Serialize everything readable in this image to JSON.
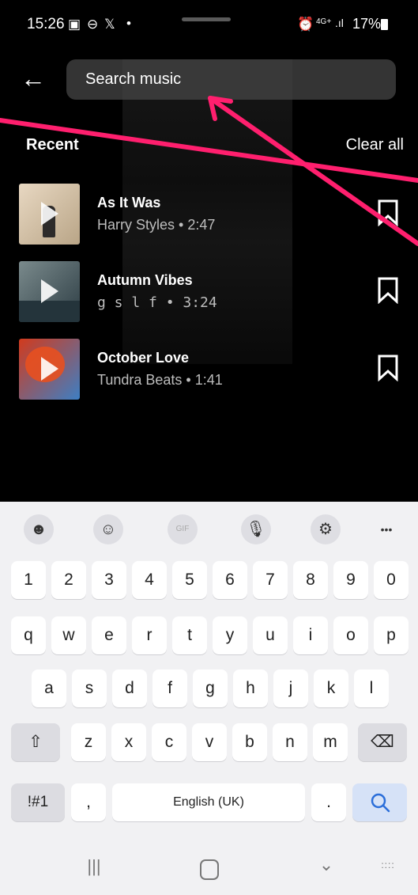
{
  "status_bar": {
    "time": "15:26",
    "left_icons": [
      "gallery-icon",
      "minus-circle-icon",
      "x-logo-icon",
      "dot-icon"
    ],
    "right_icons": [
      "alarm-icon",
      "4g-signal-icon"
    ],
    "network": "4G+",
    "battery": "17%"
  },
  "search": {
    "placeholder": "Search music"
  },
  "recent": {
    "title": "Recent",
    "clear_label": "Clear all"
  },
  "tracks": [
    {
      "title": "As It Was",
      "subtitle": "Harry Styles • 2:47",
      "thumb_colors": [
        "#e8d8c2",
        "#b9a587"
      ]
    },
    {
      "title": "Autumn Vibes",
      "subtitle": "g s l f • 3:24",
      "thumb_colors": [
        "#7a8a8c",
        "#2d3d44"
      ]
    },
    {
      "title": "October Love",
      "subtitle": "Tundra Beats • 1:41",
      "thumb_colors": [
        "#d23a1c",
        "#3d7fc4"
      ]
    }
  ],
  "annotation": {
    "arrow_color": "#ff1f6e"
  },
  "keyboard": {
    "toolbar": [
      "sticker-icon",
      "emoji-icon",
      "gif-icon",
      "microphone-icon",
      "settings-icon",
      "more-icon"
    ],
    "toolbar_gif": "GIF",
    "toolbar_more": "•••",
    "row_numbers": [
      "1",
      "2",
      "3",
      "4",
      "5",
      "6",
      "7",
      "8",
      "9",
      "0"
    ],
    "row_q": [
      "q",
      "w",
      "e",
      "r",
      "t",
      "y",
      "u",
      "i",
      "o",
      "p"
    ],
    "row_a": [
      "a",
      "s",
      "d",
      "f",
      "g",
      "h",
      "j",
      "k",
      "l"
    ],
    "row_z": [
      "z",
      "x",
      "c",
      "v",
      "b",
      "n",
      "m"
    ],
    "symbols": "!#1",
    "comma": ",",
    "space": "English (UK)",
    "period": ".",
    "accent": "#2b6ed9"
  },
  "navbar": [
    "recent-apps-icon",
    "home-icon",
    "back-chevron-icon",
    "keyboard-icon"
  ]
}
